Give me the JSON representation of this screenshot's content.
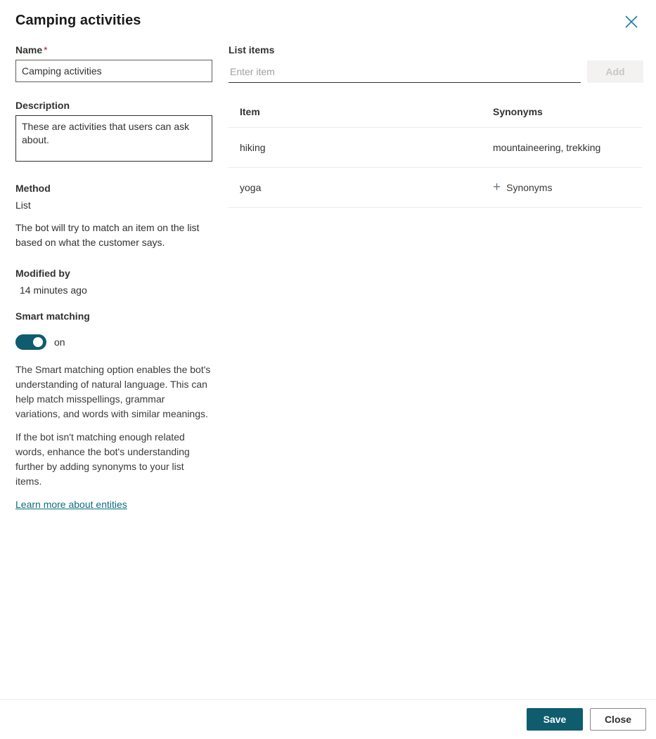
{
  "header": {
    "title": "Camping activities",
    "close_icon": "close-icon"
  },
  "left": {
    "name": {
      "label": "Name",
      "required_marker": "*",
      "value": "Camping activities"
    },
    "description": {
      "label": "Description",
      "value": "These are activities that users can ask about."
    },
    "method": {
      "label": "Method",
      "value": "List",
      "help": "The bot will try to match an item on the list based on what the customer says."
    },
    "modified_by": {
      "label": "Modified by",
      "value": "14 minutes ago"
    },
    "smart_matching": {
      "label": "Smart matching",
      "toggle_state": "on",
      "toggle_on": true,
      "paragraph_1": "The Smart matching option enables the bot's understanding of natural language. This can help match misspellings, grammar variations, and words with similar meanings.",
      "paragraph_2": "If the bot isn't matching enough related words, enhance the bot's understanding further by adding synonyms to your list items.",
      "link_text": "Learn more about entities"
    }
  },
  "right": {
    "list_items_label": "List items",
    "input_placeholder": "Enter item",
    "input_value": "",
    "add_label": "Add",
    "table": {
      "columns": [
        "Item",
        "Synonyms"
      ],
      "rows": [
        {
          "item": "hiking",
          "synonyms": "mountaineering, trekking",
          "has_synonyms": true
        },
        {
          "item": "yoga",
          "synonyms": "Synonyms",
          "has_synonyms": false
        }
      ]
    }
  },
  "footer": {
    "save_label": "Save",
    "close_label": "Close"
  },
  "colors": {
    "accent": "#0f5c6e",
    "link": "#0f6c81",
    "close_icon": "#1f7da1",
    "required": "#a4262c",
    "divider": "#edebe9",
    "disabled_bg": "#f3f2f1",
    "disabled_text": "#c8c6c4"
  }
}
